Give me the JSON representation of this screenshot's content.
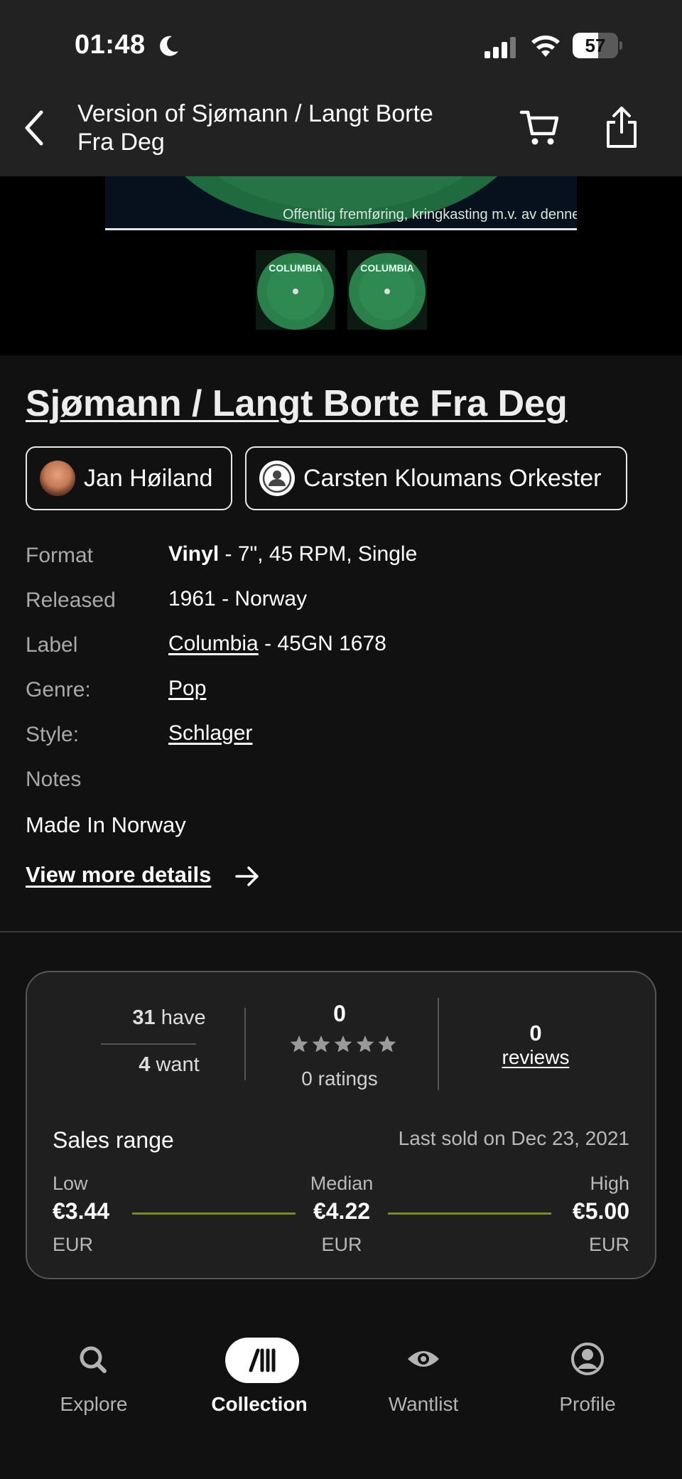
{
  "status_bar": {
    "time": "01:48",
    "battery": "57",
    "battery_level": 0.57
  },
  "header": {
    "title": "Version of Sjømann / Langt Borte Fra Deg",
    "back_icon": "chevron-left-icon",
    "cart_icon": "cart-icon",
    "share_icon": "share-icon"
  },
  "gallery": {
    "main_image_text": "Offentlig fremføring, kringkasting m.v. av denne plate forbud",
    "thumbnail_labels": [
      "COLUMBIA",
      "COLUMBIA"
    ]
  },
  "release": {
    "title": "Sjømann / Langt Borte Fra Deg",
    "artists": [
      "Jan Høiland",
      "Carsten Kloumans Orkester"
    ]
  },
  "details": {
    "format_label": "Format",
    "format_bold": "Vinyl",
    "format_rest": " - 7\", 45 RPM, Single",
    "released_label": "Released",
    "released_value": "1961 - Norway",
    "label_label": "Label",
    "label_link": "Columbia",
    "label_rest": " - 45GN 1678",
    "genre_label": "Genre:",
    "genre_value": "Pop",
    "style_label": "Style:",
    "style_value": "Schlager",
    "notes_label": "Notes",
    "notes_text": "Made In Norway",
    "view_more": "View more details"
  },
  "stats": {
    "have_count": "31",
    "have_label": "have",
    "want_count": "4",
    "want_label": "want",
    "rating_value": "0",
    "rating_stars": 0,
    "ratings_count": "0 ratings",
    "reviews_count": "0",
    "reviews_label": "reviews",
    "sales_title": "Sales range",
    "last_sold": "Last sold on Dec 23, 2021",
    "low_label": "Low",
    "low_value": "€3.44",
    "median_label": "Median",
    "median_value": "€4.22",
    "high_label": "High",
    "high_value": "€5.00",
    "currency": "EUR",
    "range_color": "#7a8a2a"
  },
  "tabs": [
    {
      "label": "Explore",
      "icon": "search-icon",
      "active": false
    },
    {
      "label": "Collection",
      "icon": "collection-icon",
      "active": true
    },
    {
      "label": "Wantlist",
      "icon": "eye-icon",
      "active": false
    },
    {
      "label": "Profile",
      "icon": "profile-icon",
      "active": false
    }
  ]
}
